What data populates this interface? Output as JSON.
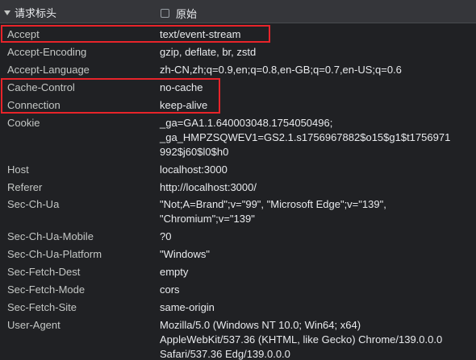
{
  "section": {
    "title": "请求标头",
    "raw_label": "原始"
  },
  "headers": [
    {
      "name": "Accept",
      "value": "text/event-stream"
    },
    {
      "name": "Accept-Encoding",
      "value": "gzip, deflate, br, zstd"
    },
    {
      "name": "Accept-Language",
      "value": "zh-CN,zh;q=0.9,en;q=0.8,en-GB;q=0.7,en-US;q=0.6"
    },
    {
      "name": "Cache-Control",
      "value": "no-cache"
    },
    {
      "name": "Connection",
      "value": "keep-alive"
    },
    {
      "name": "Cookie",
      "value": "_ga=GA1.1.640003048.1754050496;\n_ga_HMPZSQWEV1=GS2.1.s1756967882$o15$g1$t1756971\n992$j60$l0$h0"
    },
    {
      "name": "Host",
      "value": "localhost:3000"
    },
    {
      "name": "Referer",
      "value": "http://localhost:3000/"
    },
    {
      "name": "Sec-Ch-Ua",
      "value": "\"Not;A=Brand\";v=\"99\", \"Microsoft Edge\";v=\"139\",\n\"Chromium\";v=\"139\""
    },
    {
      "name": "Sec-Ch-Ua-Mobile",
      "value": "?0"
    },
    {
      "name": "Sec-Ch-Ua-Platform",
      "value": "\"Windows\""
    },
    {
      "name": "Sec-Fetch-Dest",
      "value": "empty"
    },
    {
      "name": "Sec-Fetch-Mode",
      "value": "cors"
    },
    {
      "name": "Sec-Fetch-Site",
      "value": "same-origin"
    },
    {
      "name": "User-Agent",
      "value": "Mozilla/5.0 (Windows NT 10.0; Win64; x64)\nAppleWebKit/537.36 (KHTML, like Gecko) Chrome/139.0.0.0\nSafari/537.36 Edg/139.0.0.0"
    }
  ],
  "highlight_color": "#e8242a"
}
